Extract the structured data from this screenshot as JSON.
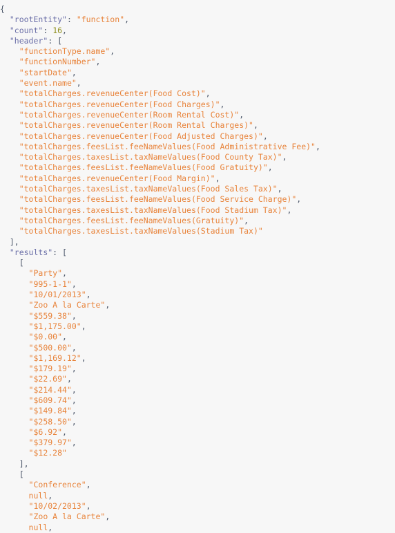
{
  "document": {
    "title": "JSON Response",
    "format": "json",
    "background_color": "#f7f7f7",
    "colors": {
      "key": "#6b6fa8",
      "string": "#e8833a",
      "number": "#8f8f1f",
      "punctuation": "#4a5568",
      "keyword": "#e8833a"
    },
    "indent_unit": "  "
  },
  "json": {
    "rootEntity": "function",
    "count": 16,
    "header": [
      "functionType.name",
      "functionNumber",
      "startDate",
      "event.name",
      "totalCharges.revenueCenter(Food Cost)",
      "totalCharges.revenueCenter(Food Charges)",
      "totalCharges.revenueCenter(Room Rental Cost)",
      "totalCharges.revenueCenter(Room Rental Charges)",
      "totalCharges.revenueCenter(Food Adjusted Charges)",
      "totalCharges.feesList.feeNameValues(Food Administrative Fee)",
      "totalCharges.taxesList.taxNameValues(Food County Tax)",
      "totalCharges.feesList.feeNameValues(Food Gratuity)",
      "totalCharges.revenueCenter(Food Margin)",
      "totalCharges.taxesList.taxNameValues(Food Sales Tax)",
      "totalCharges.feesList.feeNameValues(Food Service Charge)",
      "totalCharges.taxesList.taxNameValues(Food Stadium Tax)",
      "totalCharges.feesList.feeNameValues(Gratuity)",
      "totalCharges.taxesList.taxNameValues(Stadium Tax)"
    ],
    "results": [
      [
        "Party",
        "995-1-1",
        "10/01/2013",
        "Zoo A la Carte",
        "$559.38",
        "$1,175.00",
        "$0.00",
        "$500.00",
        "$1,169.12",
        "$179.19",
        "$22.69",
        "$214.44",
        "$609.74",
        "$149.84",
        "$258.50",
        "$6.92",
        "$379.97",
        "$12.28"
      ],
      [
        "Conference",
        null,
        "10/02/2013",
        "Zoo A la Carte"
      ]
    ]
  },
  "visible_lines": [
    {
      "indent": 0,
      "tokens": [
        {
          "t": "punc",
          "v": "{"
        }
      ]
    },
    {
      "indent": 1,
      "tokens": [
        {
          "t": "key",
          "v": "\"rootEntity\""
        },
        {
          "t": "colon",
          "v": ": "
        },
        {
          "t": "str",
          "v": "\"function\""
        },
        {
          "t": "comma",
          "v": ","
        }
      ]
    },
    {
      "indent": 1,
      "tokens": [
        {
          "t": "key",
          "v": "\"count\""
        },
        {
          "t": "colon",
          "v": ": "
        },
        {
          "t": "num",
          "v": "16"
        },
        {
          "t": "comma",
          "v": ","
        }
      ]
    },
    {
      "indent": 1,
      "tokens": [
        {
          "t": "key",
          "v": "\"header\""
        },
        {
          "t": "colon",
          "v": ": "
        },
        {
          "t": "punc",
          "v": "["
        }
      ]
    },
    {
      "indent": 2,
      "tokens": [
        {
          "t": "str",
          "v": "\"functionType.name\""
        },
        {
          "t": "comma",
          "v": ","
        }
      ]
    },
    {
      "indent": 2,
      "tokens": [
        {
          "t": "str",
          "v": "\"functionNumber\""
        },
        {
          "t": "comma",
          "v": ","
        }
      ]
    },
    {
      "indent": 2,
      "tokens": [
        {
          "t": "str",
          "v": "\"startDate\""
        },
        {
          "t": "comma",
          "v": ","
        }
      ]
    },
    {
      "indent": 2,
      "tokens": [
        {
          "t": "str",
          "v": "\"event.name\""
        },
        {
          "t": "comma",
          "v": ","
        }
      ]
    },
    {
      "indent": 2,
      "tokens": [
        {
          "t": "str",
          "v": "\"totalCharges.revenueCenter(Food Cost)\""
        },
        {
          "t": "comma",
          "v": ","
        }
      ]
    },
    {
      "indent": 2,
      "tokens": [
        {
          "t": "str",
          "v": "\"totalCharges.revenueCenter(Food Charges)\""
        },
        {
          "t": "comma",
          "v": ","
        }
      ]
    },
    {
      "indent": 2,
      "tokens": [
        {
          "t": "str",
          "v": "\"totalCharges.revenueCenter(Room Rental Cost)\""
        },
        {
          "t": "comma",
          "v": ","
        }
      ]
    },
    {
      "indent": 2,
      "tokens": [
        {
          "t": "str",
          "v": "\"totalCharges.revenueCenter(Room Rental Charges)\""
        },
        {
          "t": "comma",
          "v": ","
        }
      ]
    },
    {
      "indent": 2,
      "tokens": [
        {
          "t": "str",
          "v": "\"totalCharges.revenueCenter(Food Adjusted Charges)\""
        },
        {
          "t": "comma",
          "v": ","
        }
      ]
    },
    {
      "indent": 2,
      "tokens": [
        {
          "t": "str",
          "v": "\"totalCharges.feesList.feeNameValues(Food Administrative Fee)\""
        },
        {
          "t": "comma",
          "v": ","
        }
      ]
    },
    {
      "indent": 2,
      "tokens": [
        {
          "t": "str",
          "v": "\"totalCharges.taxesList.taxNameValues(Food County Tax)\""
        },
        {
          "t": "comma",
          "v": ","
        }
      ]
    },
    {
      "indent": 2,
      "tokens": [
        {
          "t": "str",
          "v": "\"totalCharges.feesList.feeNameValues(Food Gratuity)\""
        },
        {
          "t": "comma",
          "v": ","
        }
      ]
    },
    {
      "indent": 2,
      "tokens": [
        {
          "t": "str",
          "v": "\"totalCharges.revenueCenter(Food Margin)\""
        },
        {
          "t": "comma",
          "v": ","
        }
      ]
    },
    {
      "indent": 2,
      "tokens": [
        {
          "t": "str",
          "v": "\"totalCharges.taxesList.taxNameValues(Food Sales Tax)\""
        },
        {
          "t": "comma",
          "v": ","
        }
      ]
    },
    {
      "indent": 2,
      "tokens": [
        {
          "t": "str",
          "v": "\"totalCharges.feesList.feeNameValues(Food Service Charge)\""
        },
        {
          "t": "comma",
          "v": ","
        }
      ]
    },
    {
      "indent": 2,
      "tokens": [
        {
          "t": "str",
          "v": "\"totalCharges.taxesList.taxNameValues(Food Stadium Tax)\""
        },
        {
          "t": "comma",
          "v": ","
        }
      ]
    },
    {
      "indent": 2,
      "tokens": [
        {
          "t": "str",
          "v": "\"totalCharges.feesList.feeNameValues(Gratuity)\""
        },
        {
          "t": "comma",
          "v": ","
        }
      ]
    },
    {
      "indent": 2,
      "tokens": [
        {
          "t": "str",
          "v": "\"totalCharges.taxesList.taxNameValues(Stadium Tax)\""
        }
      ]
    },
    {
      "indent": 1,
      "tokens": [
        {
          "t": "punc",
          "v": "]"
        },
        {
          "t": "comma",
          "v": ","
        }
      ]
    },
    {
      "indent": 1,
      "tokens": [
        {
          "t": "key",
          "v": "\"results\""
        },
        {
          "t": "colon",
          "v": ": "
        },
        {
          "t": "punc",
          "v": "["
        }
      ]
    },
    {
      "indent": 2,
      "tokens": [
        {
          "t": "punc",
          "v": "["
        }
      ]
    },
    {
      "indent": 3,
      "tokens": [
        {
          "t": "str",
          "v": "\"Party\""
        },
        {
          "t": "comma",
          "v": ","
        }
      ]
    },
    {
      "indent": 3,
      "tokens": [
        {
          "t": "str",
          "v": "\"995-1-1\""
        },
        {
          "t": "comma",
          "v": ","
        }
      ]
    },
    {
      "indent": 3,
      "tokens": [
        {
          "t": "str",
          "v": "\"10/01/2013\""
        },
        {
          "t": "comma",
          "v": ","
        }
      ]
    },
    {
      "indent": 3,
      "tokens": [
        {
          "t": "str",
          "v": "\"Zoo A la Carte\""
        },
        {
          "t": "comma",
          "v": ","
        }
      ]
    },
    {
      "indent": 3,
      "tokens": [
        {
          "t": "str",
          "v": "\"$559.38\""
        },
        {
          "t": "comma",
          "v": ","
        }
      ]
    },
    {
      "indent": 3,
      "tokens": [
        {
          "t": "str",
          "v": "\"$1,175.00\""
        },
        {
          "t": "comma",
          "v": ","
        }
      ]
    },
    {
      "indent": 3,
      "tokens": [
        {
          "t": "str",
          "v": "\"$0.00\""
        },
        {
          "t": "comma",
          "v": ","
        }
      ]
    },
    {
      "indent": 3,
      "tokens": [
        {
          "t": "str",
          "v": "\"$500.00\""
        },
        {
          "t": "comma",
          "v": ","
        }
      ]
    },
    {
      "indent": 3,
      "tokens": [
        {
          "t": "str",
          "v": "\"$1,169.12\""
        },
        {
          "t": "comma",
          "v": ","
        }
      ]
    },
    {
      "indent": 3,
      "tokens": [
        {
          "t": "str",
          "v": "\"$179.19\""
        },
        {
          "t": "comma",
          "v": ","
        }
      ]
    },
    {
      "indent": 3,
      "tokens": [
        {
          "t": "str",
          "v": "\"$22.69\""
        },
        {
          "t": "comma",
          "v": ","
        }
      ]
    },
    {
      "indent": 3,
      "tokens": [
        {
          "t": "str",
          "v": "\"$214.44\""
        },
        {
          "t": "comma",
          "v": ","
        }
      ]
    },
    {
      "indent": 3,
      "tokens": [
        {
          "t": "str",
          "v": "\"$609.74\""
        },
        {
          "t": "comma",
          "v": ","
        }
      ]
    },
    {
      "indent": 3,
      "tokens": [
        {
          "t": "str",
          "v": "\"$149.84\""
        },
        {
          "t": "comma",
          "v": ","
        }
      ]
    },
    {
      "indent": 3,
      "tokens": [
        {
          "t": "str",
          "v": "\"$258.50\""
        },
        {
          "t": "comma",
          "v": ","
        }
      ]
    },
    {
      "indent": 3,
      "tokens": [
        {
          "t": "str",
          "v": "\"$6.92\""
        },
        {
          "t": "comma",
          "v": ","
        }
      ]
    },
    {
      "indent": 3,
      "tokens": [
        {
          "t": "str",
          "v": "\"$379.97\""
        },
        {
          "t": "comma",
          "v": ","
        }
      ]
    },
    {
      "indent": 3,
      "tokens": [
        {
          "t": "str",
          "v": "\"$12.28\""
        }
      ]
    },
    {
      "indent": 2,
      "tokens": [
        {
          "t": "punc",
          "v": "]"
        },
        {
          "t": "comma",
          "v": ","
        }
      ]
    },
    {
      "indent": 2,
      "tokens": [
        {
          "t": "punc",
          "v": "["
        }
      ]
    },
    {
      "indent": 3,
      "tokens": [
        {
          "t": "str",
          "v": "\"Conference\""
        },
        {
          "t": "comma",
          "v": ","
        }
      ]
    },
    {
      "indent": 3,
      "tokens": [
        {
          "t": "kw",
          "v": "null"
        },
        {
          "t": "comma",
          "v": ","
        }
      ]
    },
    {
      "indent": 3,
      "tokens": [
        {
          "t": "str",
          "v": "\"10/02/2013\""
        },
        {
          "t": "comma",
          "v": ","
        }
      ]
    },
    {
      "indent": 3,
      "tokens": [
        {
          "t": "str",
          "v": "\"Zoo A la Carte\""
        },
        {
          "t": "comma",
          "v": ","
        }
      ]
    },
    {
      "indent": 3,
      "tokens": [
        {
          "t": "kw",
          "v": "null"
        },
        {
          "t": "comma",
          "v": ","
        }
      ]
    }
  ]
}
